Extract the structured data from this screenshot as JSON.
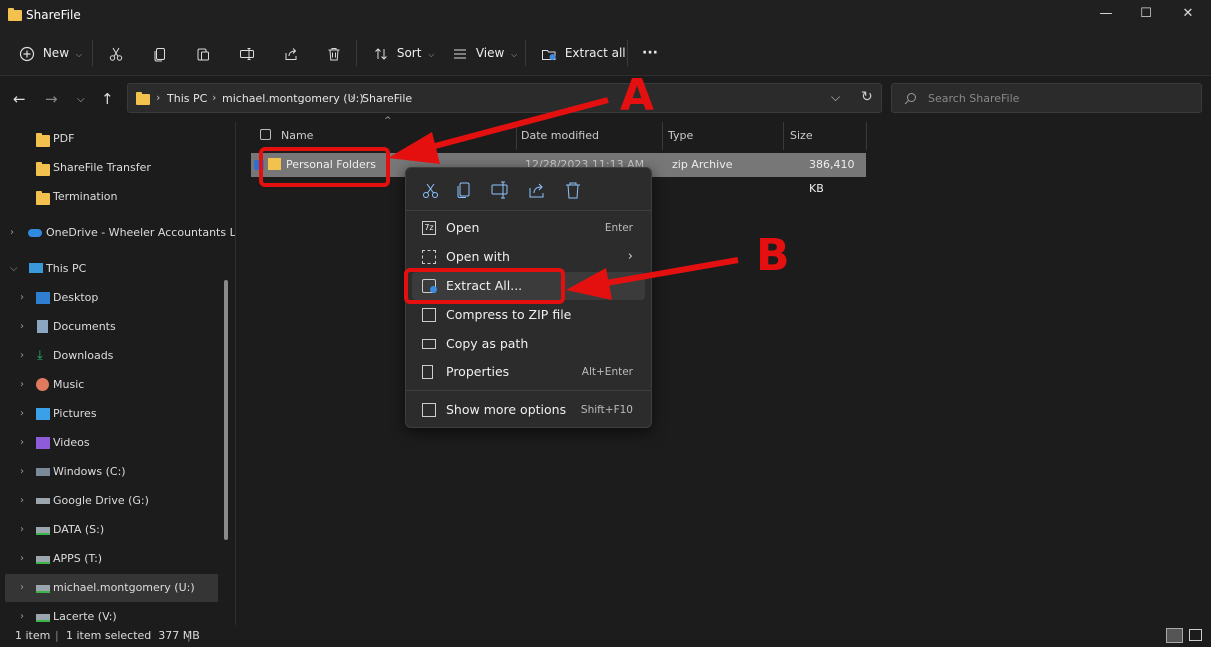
{
  "window": {
    "title": "ShareFile",
    "controls": {
      "minimize": "—",
      "maximize": "☐",
      "close": "✕"
    }
  },
  "toolbar": {
    "new_label": "New",
    "sort_label": "Sort",
    "view_label": "View",
    "extract_all_label": "Extract all",
    "more_label": "···"
  },
  "address": {
    "segments": [
      "This PC",
      "michael.montgomery (U:)",
      "ShareFile"
    ],
    "search_placeholder": "Search ShareFile"
  },
  "sidebar": {
    "items": [
      {
        "label": "PDF",
        "icon": "folder-icon"
      },
      {
        "label": "ShareFile Transfer",
        "icon": "folder-icon"
      },
      {
        "label": "Termination",
        "icon": "folder-icon"
      },
      {
        "label": "OneDrive - Wheeler Accountants LLP",
        "icon": "onedrive-icon"
      },
      {
        "label": "This PC",
        "icon": "pc-icon"
      },
      {
        "label": "Desktop",
        "icon": "desktop-icon"
      },
      {
        "label": "Documents",
        "icon": "documents-icon"
      },
      {
        "label": "Downloads",
        "icon": "downloads-icon"
      },
      {
        "label": "Music",
        "icon": "music-icon"
      },
      {
        "label": "Pictures",
        "icon": "pictures-icon"
      },
      {
        "label": "Videos",
        "icon": "videos-icon"
      },
      {
        "label": "Windows (C:)",
        "icon": "drive-icon"
      },
      {
        "label": "Google Drive (G:)",
        "icon": "drive-icon"
      },
      {
        "label": "DATA (S:)",
        "icon": "network-drive-icon"
      },
      {
        "label": "APPS (T:)",
        "icon": "network-drive-icon"
      },
      {
        "label": "michael.montgomery (U:)",
        "icon": "network-drive-icon"
      },
      {
        "label": "Lacerte (V:)",
        "icon": "network-drive-icon"
      }
    ]
  },
  "columns": {
    "name": "Name",
    "date": "Date modified",
    "type": "Type",
    "size": "Size"
  },
  "file": {
    "name": "Personal Folders",
    "date": "12/28/2023 11:13 AM",
    "type": "zip Archive",
    "size": "386,410 KB"
  },
  "context_menu": {
    "items": [
      {
        "label": "Open",
        "shortcut": "Enter"
      },
      {
        "label": "Open with",
        "shortcut": ""
      },
      {
        "label": "Extract All...",
        "shortcut": ""
      },
      {
        "label": "Compress to ZIP file",
        "shortcut": ""
      },
      {
        "label": "Copy as path",
        "shortcut": ""
      },
      {
        "label": "Properties",
        "shortcut": "Alt+Enter"
      },
      {
        "label": "Show more options",
        "shortcut": "Shift+F10"
      }
    ]
  },
  "annotations": {
    "a": "A",
    "b": "B",
    "color": "#e41010"
  },
  "status": {
    "count": "1 item",
    "selected": "1 item selected  377 MB"
  }
}
